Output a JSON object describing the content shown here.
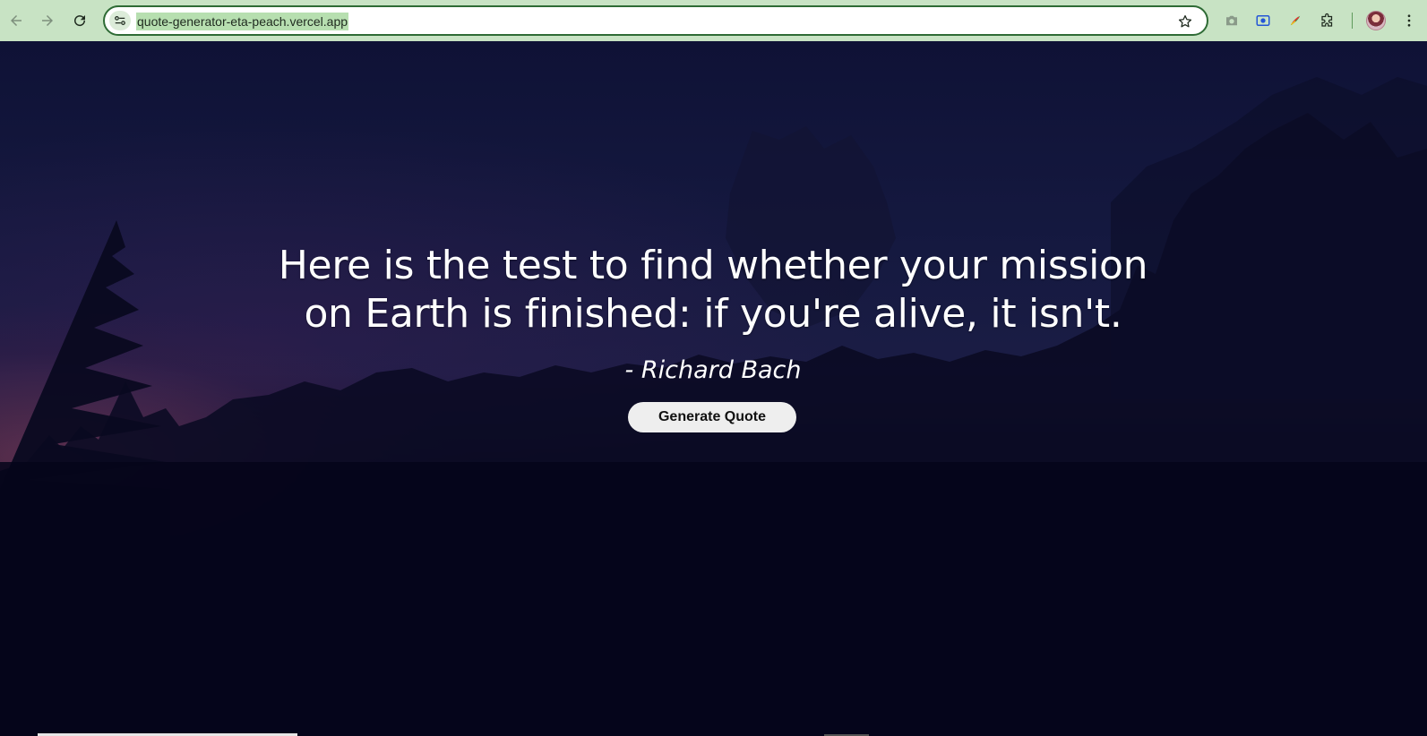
{
  "browser": {
    "url": "quote-generator-eta-peach.vercel.app",
    "nav": {
      "back_icon": "arrow-left-icon",
      "forward_icon": "arrow-right-icon",
      "reload_icon": "reload-icon"
    },
    "site_info_icon": "tune-icon",
    "bookmark_icon": "star-icon",
    "extensions": [
      "camera-icon",
      "screen-capture-icon",
      "color-picker-icon",
      "puzzle-icon"
    ],
    "menu_icon": "kebab-menu-icon",
    "colors": {
      "toolbar": "#c8e3c4",
      "omnibox_border": "#2e6b35",
      "url_highlight": "#b7dfb0"
    }
  },
  "main": {
    "quote": "Here is the test to find whether your mission on Earth is finished: if you're alive, it isn't.",
    "author": "- Richard Bach",
    "button_label": "Generate Quote"
  }
}
